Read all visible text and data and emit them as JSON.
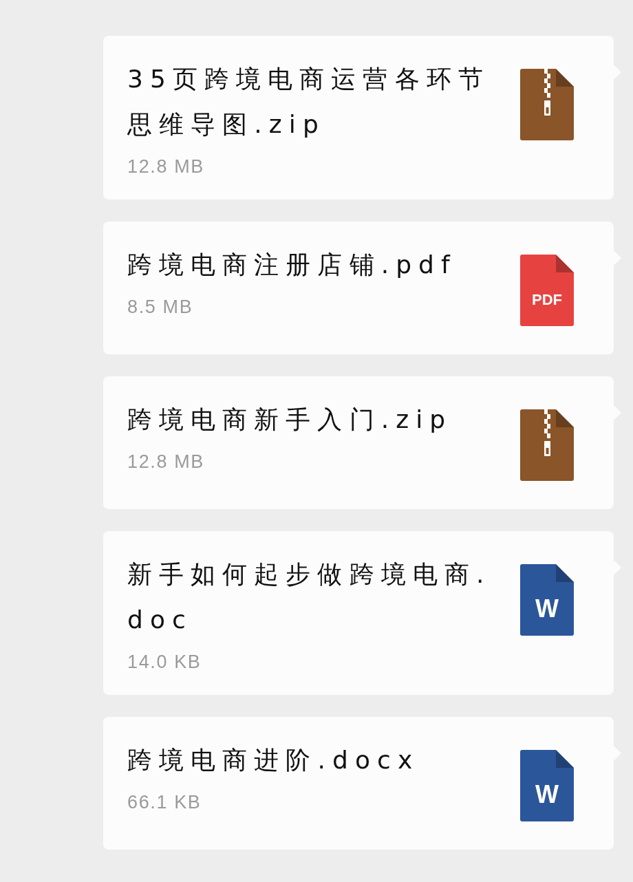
{
  "messages": [
    {
      "kind": "zip",
      "filename": "35页跨境电商运营各环节思维导图.zip",
      "size": "12.8 MB"
    },
    {
      "kind": "pdf",
      "filename": "跨境电商注册店铺.pdf",
      "size": "8.5 MB",
      "icon_label": "PDF"
    },
    {
      "kind": "zip",
      "filename": "跨境电商新手入门.zip",
      "size": "12.8 MB"
    },
    {
      "kind": "word",
      "filename": "新手如何起步做跨境电商.doc",
      "size": "14.0 KB",
      "icon_label": "W"
    },
    {
      "kind": "word",
      "filename": "跨境电商进阶.docx",
      "size": "66.1 KB",
      "icon_label": "W"
    }
  ]
}
